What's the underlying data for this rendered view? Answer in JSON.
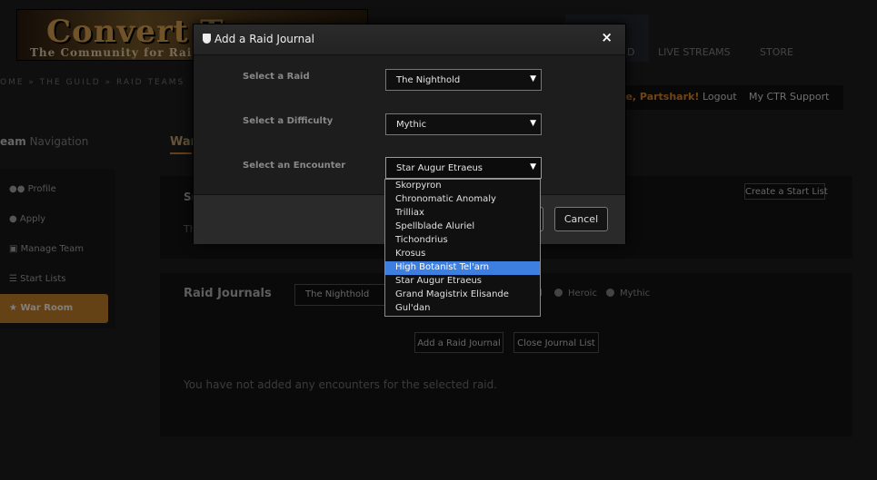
{
  "banner": {
    "title": "Convert T",
    "subtitle": "The Community for Raiders"
  },
  "topnav": {
    "item1": "D",
    "live_streams": "LIVE STREAMS",
    "store": "STORE"
  },
  "breadcrumb": "OME » THE GUILD » RAID TEAMS",
  "userbar": {
    "welcome": "me, Partshark!",
    "logout": "Logout",
    "my_ctr": "My CTR",
    "support": "Support"
  },
  "team_nav": {
    "title_bold": "eam",
    "title_rest": "Navigation",
    "items": [
      {
        "label": "Profile",
        "icon": "users-icon"
      },
      {
        "label": "Apply",
        "icon": "user-icon"
      },
      {
        "label": "Manage Team",
        "icon": "sitemap-icon"
      },
      {
        "label": "Start Lists",
        "icon": "list-icon"
      },
      {
        "label": "War Room",
        "icon": "trophy-icon"
      }
    ]
  },
  "main": {
    "heading": "War",
    "start_panel": {
      "title": "Sı",
      "text": "Th",
      "create_button": "Create a Start List"
    },
    "raid_journals": {
      "title": "Raid Journals",
      "raid_select": "The Nighthold",
      "difficulty_partial": "l",
      "heroic": "Heroic",
      "mythic": "Mythic",
      "add_button": "Add a Raid Journal",
      "close_button": "Close Journal List",
      "empty_message": "You have not added any encounters for the selected raid."
    }
  },
  "modal": {
    "title": "Add a Raid Journal",
    "close_symbol": "×",
    "fields": {
      "raid_label": "Select a Raid",
      "raid_value": "The Nighthold",
      "difficulty_label": "Select a Difficulty",
      "difficulty_value": "Mythic",
      "encounter_label": "Select an Encounter",
      "encounter_value": "Star Augur Etraeus"
    },
    "ok_button": "",
    "cancel_button": "Cancel",
    "encounter_options": [
      "Skorpyron",
      "Chronomatic Anomaly",
      "Trilliax",
      "Spellblade Aluriel",
      "Tichondrius",
      "Krosus",
      "High Botanist Tel'arn",
      "Star Augur Etraeus",
      "Grand Magistrix Elisande",
      "Gul'dan"
    ],
    "highlighted_option": "High Botanist Tel'arn"
  },
  "colors": {
    "accent": "#c9842c",
    "highlight": "#3d7fe0",
    "welcome": "#e08a2c"
  }
}
